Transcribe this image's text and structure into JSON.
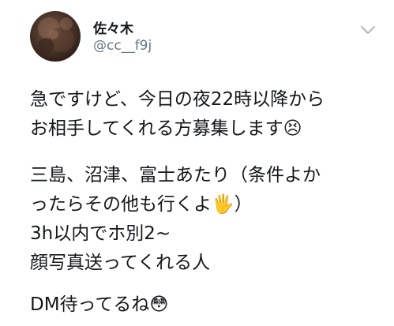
{
  "user": {
    "display_name": "佐々木",
    "handle": "@cc__f9j"
  },
  "tweet": {
    "lines": [
      "急ですけど、今日の夜22時以降から",
      "お相手してくれる方募集します😣",
      "三島、沼津、富士あたり（条件よか",
      "ったらその他も行くよ🖐️）",
      "3h以内でホ別2~",
      "顔写真送ってくれる人",
      "DM待ってるね😳"
    ]
  },
  "icons": {
    "menu": "chevron-down-icon",
    "avatar": "profile-photo"
  }
}
